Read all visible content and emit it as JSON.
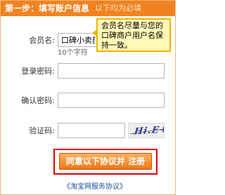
{
  "header": {
    "title": "第一步：填写账户信息",
    "subtitle": "以下均为必填"
  },
  "form": {
    "member_name": {
      "label": "会员名:",
      "value": "口碑小卖部",
      "hint": "10个字符"
    },
    "login_password": {
      "label": "登录密码:",
      "value": ""
    },
    "confirm_password": {
      "label": "确认密码:",
      "value": ""
    },
    "captcha": {
      "label": "验证码:",
      "value": "",
      "image_text": "Hi.E+"
    }
  },
  "tooltip": {
    "text": "会员名尽量与您的口碑商户用户名保持一致。"
  },
  "submit": {
    "label": "同意以下协议并 注册"
  },
  "agreement": {
    "label": "《淘宝网服务协议》"
  },
  "colors": {
    "accent": "#f08321",
    "highlight_border": "#e00000",
    "tooltip_bg": "#fff9b8",
    "link": "#1a4fa0"
  }
}
